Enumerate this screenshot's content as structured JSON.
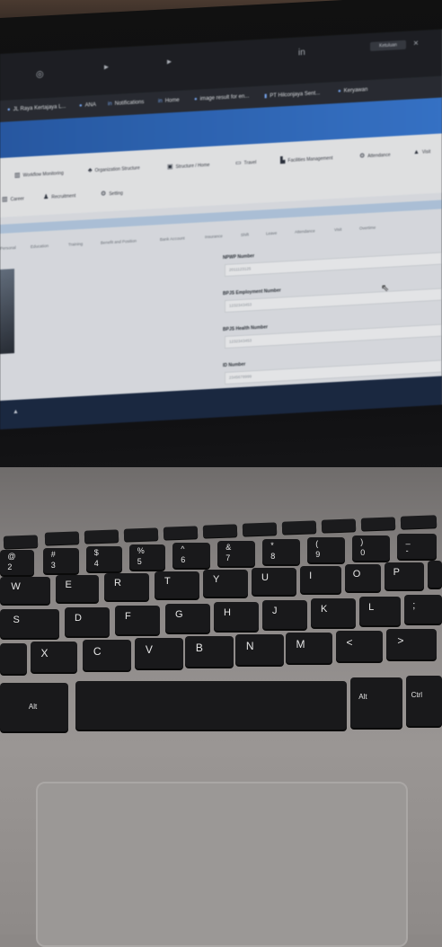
{
  "browser": {
    "window_button": "Ketuluan",
    "bookmarks": [
      "JL Raya Kertajaya L...",
      "ANA",
      "Notifications",
      "Home",
      "image result for en...",
      "PT Hilconjaya Sent...",
      "Keryawan"
    ]
  },
  "app": {
    "menu_row1": [
      "Workflow Monitoring",
      "Organization Structure",
      "Structure / Home",
      "Travel",
      "Facilities Management",
      "Attendance",
      "Visit"
    ],
    "menu_row2": [
      "Career",
      "Recruitment",
      "Setting"
    ],
    "tabs": [
      "Personal",
      "Education",
      "Training",
      "Benefit and Position",
      "Bank Account",
      "Insurance",
      "Shift",
      "Leave",
      "Attendance",
      "Visit",
      "Overtime"
    ],
    "fields": [
      {
        "label": "NPWP Number",
        "value": "2011123125"
      },
      {
        "label": "BPJS Employment Number",
        "value": "1232343453"
      },
      {
        "label": "BPJS Health Number",
        "value": "1232343453"
      },
      {
        "label": "ID Number",
        "value": "2345678999"
      }
    ]
  },
  "keyboard": {
    "number_row": [
      {
        "top": "@",
        "main": "2"
      },
      {
        "top": "#",
        "main": "3"
      },
      {
        "top": "$",
        "main": "4"
      },
      {
        "top": "%",
        "main": "5"
      },
      {
        "top": "^",
        "main": "6"
      },
      {
        "top": "&",
        "main": "7"
      },
      {
        "top": "*",
        "main": "8"
      },
      {
        "top": "(",
        "main": "9"
      },
      {
        "top": ")",
        "main": "0"
      },
      {
        "top": "_",
        "main": "-"
      }
    ],
    "row_qwerty": [
      "W",
      "E",
      "R",
      "T",
      "Y",
      "U",
      "I",
      "O",
      "P"
    ],
    "row_home": [
      "S",
      "D",
      "F",
      "G",
      "H",
      "J",
      "K",
      "L",
      ";"
    ],
    "row_bottom": [
      "X",
      "C",
      "V",
      "B",
      "N",
      "M",
      "<",
      ">"
    ],
    "modifiers": {
      "alt_left": "Alt",
      "alt_right": "Alt",
      "ctrl": "Ctrl"
    }
  }
}
